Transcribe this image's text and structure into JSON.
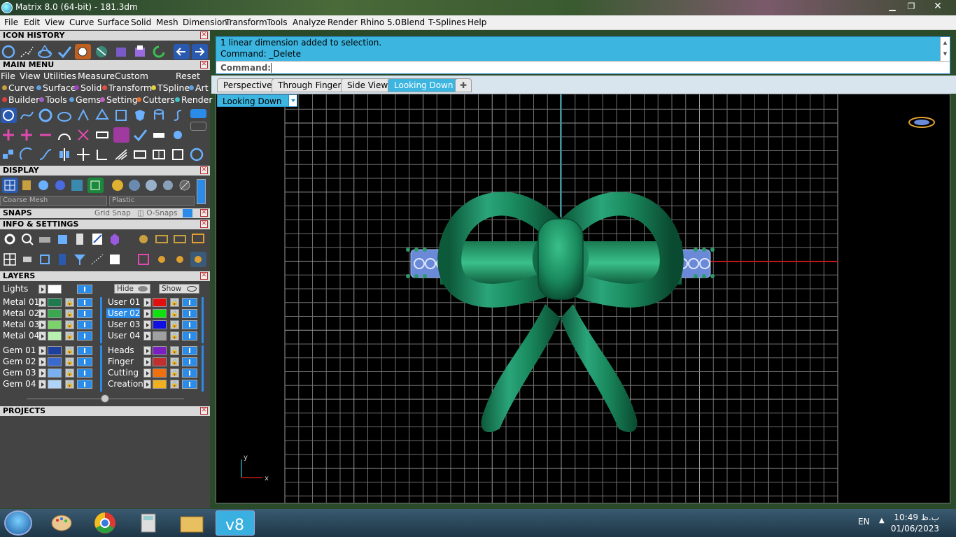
{
  "window": {
    "title": "Matrix 8.0 (64-bit) - 181.3dm",
    "minimize": "▁",
    "restore": "❐",
    "close": "✕"
  },
  "menubar": {
    "items": [
      "File",
      "Edit",
      "View",
      "Curve",
      "Surface",
      "Solid",
      "Mesh",
      "Dimension",
      "Transform",
      "Tools",
      "Analyze",
      "Render",
      "Rhino 5.0",
      "Blend",
      "T-Splines",
      "Help"
    ]
  },
  "panels": {
    "icon_history": "ICON HISTORY",
    "main_menu": "MAIN MENU",
    "display": "DISPLAY",
    "snaps": "SNAPS",
    "info_settings": "INFO & SETTINGS",
    "layers": "LAYERS",
    "projects": "PROJECTS"
  },
  "main_menu": {
    "row1": [
      "File",
      "View",
      "Utilities",
      "Measure",
      "Custom"
    ],
    "reset": "Reset",
    "row2": [
      {
        "label": "Curve",
        "color": "#c8a040"
      },
      {
        "label": "Surface",
        "color": "#60a0e0"
      },
      {
        "label": "Solid",
        "color": "#a040c0"
      },
      {
        "label": "Transform",
        "color": "#e05040"
      },
      {
        "label": "TSpline",
        "color": "#e0d040"
      },
      {
        "label": "Art",
        "color": "#60a0e0"
      }
    ],
    "row3": [
      {
        "label": "Builder",
        "color": "#e04040"
      },
      {
        "label": "Tools",
        "color": "#a060c0"
      },
      {
        "label": "Gems",
        "color": "#60a0e0"
      },
      {
        "label": "Setting",
        "color": "#c060c0"
      },
      {
        "label": "Cutters",
        "color": "#e07030"
      },
      {
        "label": "Render",
        "color": "#40c0c0"
      }
    ]
  },
  "display": {
    "mesh": "Coarse Mesh",
    "material": "Plastic"
  },
  "snaps": {
    "grid": "Grid Snap",
    "osnaps": "O-Snaps"
  },
  "layers": {
    "lights": "Lights",
    "hide": "Hide",
    "show": "Show",
    "left": [
      {
        "name": "Metal 01",
        "color": "#1f7a4f"
      },
      {
        "name": "Metal 02",
        "color": "#3aa84e"
      },
      {
        "name": "Metal 03",
        "color": "#7cd36a"
      },
      {
        "name": "Metal 04",
        "color": "#b8f0b0"
      },
      {
        "name": "Gem 01",
        "color": "#1c3fa0"
      },
      {
        "name": "Gem 02",
        "color": "#3a6ad0"
      },
      {
        "name": "Gem 03",
        "color": "#7ab0f0"
      },
      {
        "name": "Gem 04",
        "color": "#b0d4f8"
      }
    ],
    "right": [
      {
        "name": "User 01",
        "color": "#e01010"
      },
      {
        "name": "User 02",
        "color": "#10e010"
      },
      {
        "name": "User 03",
        "color": "#1010e0"
      },
      {
        "name": "User 04",
        "color": "#a0a0a0"
      },
      {
        "name": "Heads",
        "color": "#7a20c0"
      },
      {
        "name": "Finger",
        "color": "#c03030"
      },
      {
        "name": "Cutting",
        "color": "#f07010"
      },
      {
        "name": "Creation",
        "color": "#f0b020"
      }
    ]
  },
  "command": {
    "line1": "1 linear dimension added to selection.",
    "line2": "Command: _Delete",
    "label": "Command:",
    "value": ""
  },
  "tabs": [
    "Perspective",
    "Through Finger",
    "Side View",
    "Looking Down"
  ],
  "add_tab": "✚",
  "viewport": {
    "label": "Looking Down",
    "axis_y": "y",
    "axis_x": "x"
  },
  "taskbar": {
    "lang": "EN",
    "time": "10:49 ب.ظ",
    "date": "01/06/2023"
  }
}
